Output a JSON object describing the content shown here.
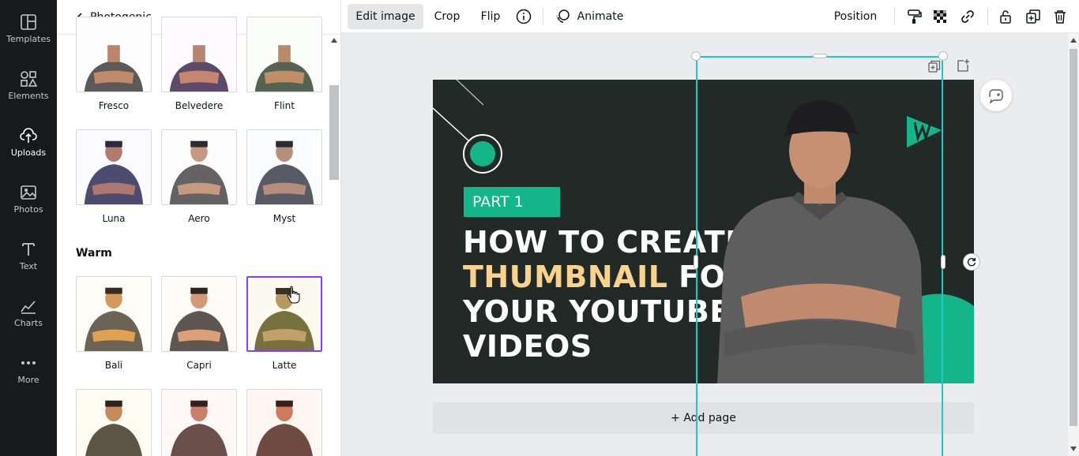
{
  "rail": {
    "items": [
      {
        "label": "Templates",
        "icon": "templates-icon"
      },
      {
        "label": "Elements",
        "icon": "elements-icon"
      },
      {
        "label": "Uploads",
        "icon": "uploads-icon"
      },
      {
        "label": "Photos",
        "icon": "photos-icon"
      },
      {
        "label": "Text",
        "icon": "text-icon"
      },
      {
        "label": "Charts",
        "icon": "charts-icon"
      },
      {
        "label": "More",
        "icon": "more-icon"
      }
    ],
    "active": "Uploads"
  },
  "panel": {
    "back_label": "Photogenic",
    "section_warm": "Warm",
    "filters_row1": [
      "Fresco",
      "Belvedere",
      "Flint"
    ],
    "filters_row2": [
      "Luna",
      "Aero",
      "Myst"
    ],
    "filters_warm": [
      "Bali",
      "Capri",
      "Latte"
    ],
    "selected_filter": "Latte"
  },
  "toolbar": {
    "edit_image": "Edit image",
    "crop": "Crop",
    "flip": "Flip",
    "animate": "Animate",
    "position": "Position"
  },
  "design": {
    "badge": "PART 1",
    "headline_line1": "HOW TO CREATE",
    "headline_line2_accent": "THUMBNAIL",
    "headline_line2_rest": " FOR",
    "headline_line3": "YOUR YOUTUBE",
    "headline_line4": "VIDEOS",
    "bg_color": "#222a28",
    "accent_color": "#14b58a",
    "highlight_color": "#f9d38d"
  },
  "canvas": {
    "add_page": "+ Add page",
    "selection_color": "#1fc7c9"
  }
}
